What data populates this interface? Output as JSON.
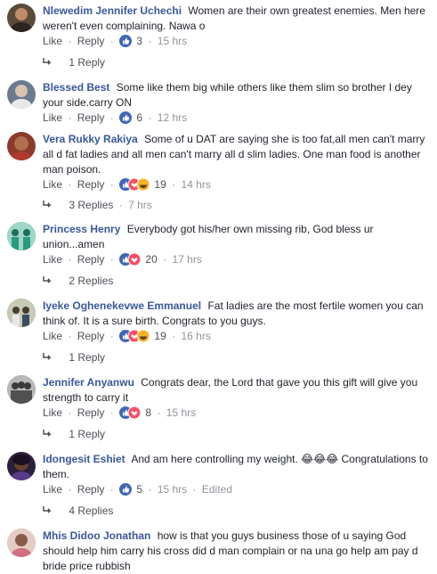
{
  "actions": {
    "like": "Like",
    "reply": "Reply",
    "sep": "·"
  },
  "comments": [
    {
      "name": "Nlewedim Jennifer Uchechi",
      "text": "Women are their own greatest enemies. Men here weren't even complaining. Nawa o",
      "reactions": [
        "like"
      ],
      "count": "3",
      "time": "15 hrs",
      "replies": "1 Reply",
      "avatar_color": "#5a4a3a"
    },
    {
      "name": "Blessed Best",
      "text": "Some like them big while others like them slim so brother I dey your side.carry ON",
      "reactions": [
        "like"
      ],
      "count": "6",
      "time": "12 hrs",
      "replies": "",
      "avatar_color": "#6b7a8c"
    },
    {
      "name": "Vera Rukky Rakiya",
      "text": "Some of u DAT are saying she is too fat,all men can't marry all d fat ladies and all men can't marry all d slim ladies. One man food is another man poison.",
      "reactions": [
        "like",
        "love",
        "haha"
      ],
      "count": "19",
      "time": "14 hrs",
      "replies": "3 Replies",
      "reply_time": "7 hrs",
      "avatar_color": "#8a3b2c"
    },
    {
      "name": "Princess Henry",
      "text": "Everybody got his/her own missing rib, God bless ur union...amen",
      "reactions": [
        "like",
        "love"
      ],
      "count": "20",
      "time": "17 hrs",
      "replies": "2 Replies",
      "avatar_color": "#2f8f7a"
    },
    {
      "name": "Iyeke Oghenekevwe Emmanuel",
      "text": "Fat ladies are the most fertile women you can think of. It is a sure birth. Congrats to you guys.",
      "reactions": [
        "like",
        "love",
        "haha"
      ],
      "count": "19",
      "time": "16 hrs",
      "replies": "1 Reply",
      "avatar_color": "#7d8a6a"
    },
    {
      "name": "Jennifer Anyanwu",
      "text": "Congrats dear, the Lord that gave you this gift will give you strength to carry it",
      "reactions": [
        "like",
        "love"
      ],
      "count": "8",
      "time": "15 hrs",
      "replies": "1 Reply",
      "avatar_color": "#7a7a7a"
    },
    {
      "name": "Idongesit Eshiet",
      "text": "And am here controlling my weight. 😂😂😂 Congratulations to them.",
      "reactions": [
        "like"
      ],
      "count": "5",
      "time": "15 hrs",
      "edited": "Edited",
      "replies": "4 Replies",
      "avatar_color": "#2a1f3d"
    },
    {
      "name": "Mhis Didoo Jonathan",
      "text": "how is that you guys business those of u saying God should help him carry his cross did d man complain or na una go help am pay d bride price rubbish",
      "reactions": [],
      "count": "",
      "time": "",
      "replies": "",
      "avatar_color": "#c9a6a0"
    }
  ],
  "colors": {
    "name": "#385898",
    "like": "#4267b2",
    "love": "#f25268",
    "haha": "#f7b125"
  }
}
